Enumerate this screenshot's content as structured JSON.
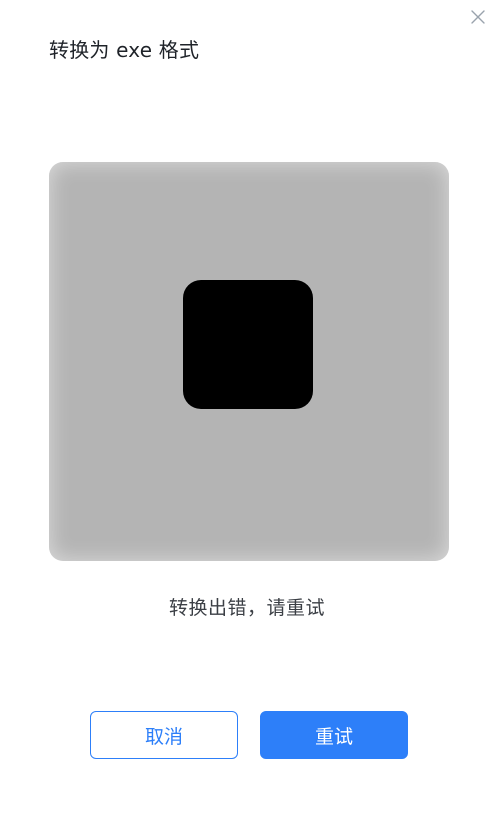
{
  "dialog": {
    "title": "转换为 exe 格式",
    "close_icon": "close-icon"
  },
  "preview": {
    "icon": "stop-icon",
    "background_color": "#b4b4b4",
    "icon_color": "#000000"
  },
  "status": {
    "message": "转换出错，请重试"
  },
  "actions": {
    "cancel_label": "取消",
    "retry_label": "重试",
    "accent_color": "#2d7ff9"
  }
}
